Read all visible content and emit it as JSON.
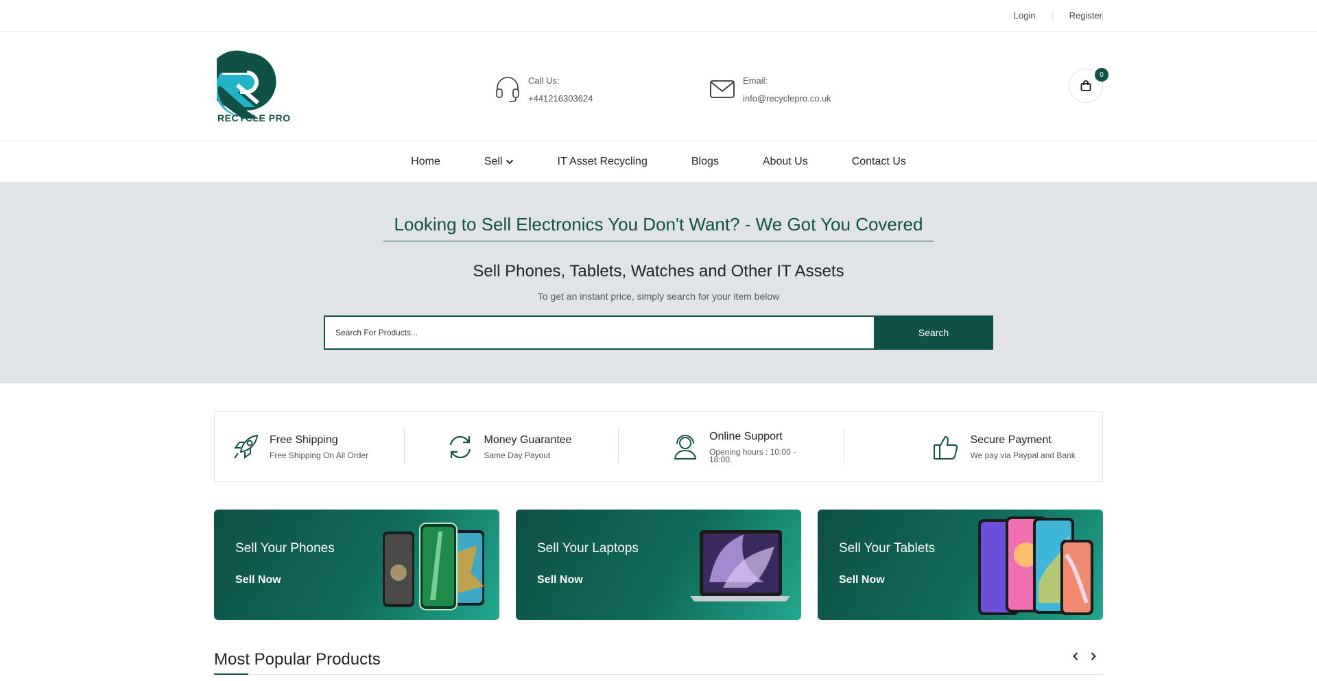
{
  "topbar": {
    "login": "Login",
    "register": "Register"
  },
  "brand": {
    "name": "RECYCLE PRO",
    "color": "#0f5147",
    "accent": "#23b3c8"
  },
  "header": {
    "call_label": "Call Us:",
    "call_value": "+441216303624",
    "email_label": "Email:",
    "email_value": "info@recyclepro.co.uk",
    "cart_count": "0"
  },
  "nav": {
    "items": [
      {
        "label": "Home"
      },
      {
        "label": "Sell"
      },
      {
        "label": "IT Asset Recycling"
      },
      {
        "label": "Blogs"
      },
      {
        "label": "About Us"
      },
      {
        "label": "Contact Us"
      }
    ]
  },
  "hero": {
    "headline": "Looking to Sell Electronics You Don't Want? - We Got You Covered",
    "subheadline": "Sell Phones, Tablets, Watches and Other IT Assets",
    "helper": "To get an instant price, simply search for your item below",
    "search_placeholder": "Search For Products...",
    "search_button": "Search"
  },
  "features": [
    {
      "title": "Free Shipping",
      "subtitle": "Free Shipping On All Order",
      "icon": "rocket-icon"
    },
    {
      "title": "Money Guarantee",
      "subtitle": "Same Day Payout",
      "icon": "refresh-icon"
    },
    {
      "title": "Online Support",
      "subtitle": "Opening hours : 10:00 - 18:00.",
      "icon": "support-agent-icon"
    },
    {
      "title": "Secure Payment",
      "subtitle": "We pay via Paypal and Bank",
      "icon": "thumbs-up-icon"
    }
  ],
  "cards": [
    {
      "title": "Sell Your Phones",
      "cta": "Sell Now"
    },
    {
      "title": "Sell Your Laptops",
      "cta": "Sell Now"
    },
    {
      "title": "Sell Your Tablets",
      "cta": "Sell Now"
    }
  ],
  "popular": {
    "title": "Most Popular Products"
  }
}
